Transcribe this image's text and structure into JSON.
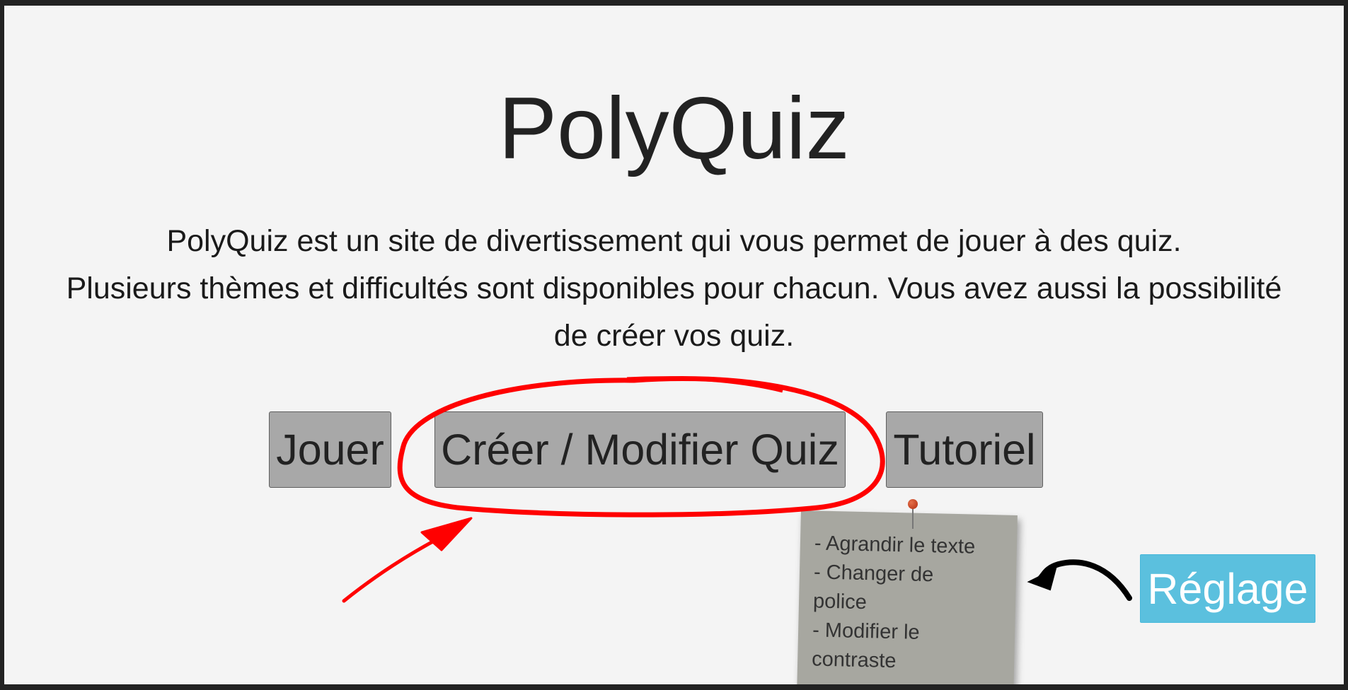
{
  "app": {
    "title": "PolyQuiz",
    "description_lines": [
      "PolyQuiz est un site de divertissement qui vous permet de jouer à des quiz.",
      "Plusieurs thèmes et difficultés sont disponibles pour chacun. Vous avez aussi la possibilité",
      "de créer vos quiz."
    ]
  },
  "buttons": {
    "play_label": "Jouer",
    "create_label": "Créer / Modifier Quiz",
    "tutorial_label": "Tutoriel",
    "settings_label": "Réglage"
  },
  "sticky_note": {
    "lines": [
      "- Agrandir le texte",
      "- Changer de",
      "police",
      "- Modifier le",
      "contraste"
    ]
  },
  "colors": {
    "button_gray": "#a8a8a8",
    "settings_blue": "#5bc0de",
    "annotation_red": "#ff0000",
    "note_gray": "#a7a7a0"
  },
  "icons": {
    "annotation_circle": "red-circle-highlight",
    "annotation_red_arrow": "red-arrow",
    "annotation_black_arrow": "black-arrow",
    "pin": "push-pin-icon"
  }
}
